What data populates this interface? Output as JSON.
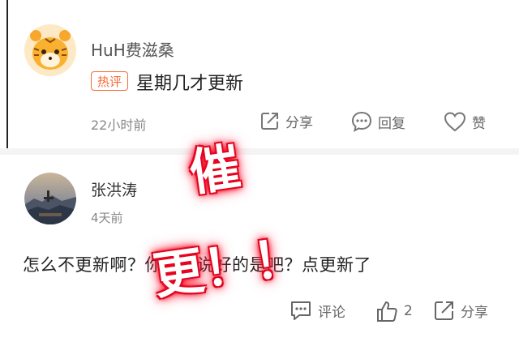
{
  "comment1": {
    "username": "HuH费滋桑",
    "tag": "热评",
    "text": "星期几才更新",
    "time": "22小时前",
    "actions": {
      "share": "分享",
      "reply": "回复",
      "like": "赞"
    }
  },
  "comment2": {
    "username": "张洪涛",
    "time": "4天前",
    "text": "怎么不更新啊？你怎么说好的是吧？点更新了",
    "actions": {
      "comment": "评论",
      "likes": "2",
      "share": "分享"
    }
  },
  "overlay": {
    "text": "催更！！"
  },
  "colors": {
    "hot_tag": "#f56a35",
    "overlay_glow": "#e0001a",
    "muted": "#888888"
  },
  "icons": [
    "tiger-avatar",
    "landscape-avatar",
    "share-arrow-icon",
    "reply-bubble-icon",
    "heart-icon",
    "comment-bubble-icon",
    "thumbs-up-icon"
  ]
}
